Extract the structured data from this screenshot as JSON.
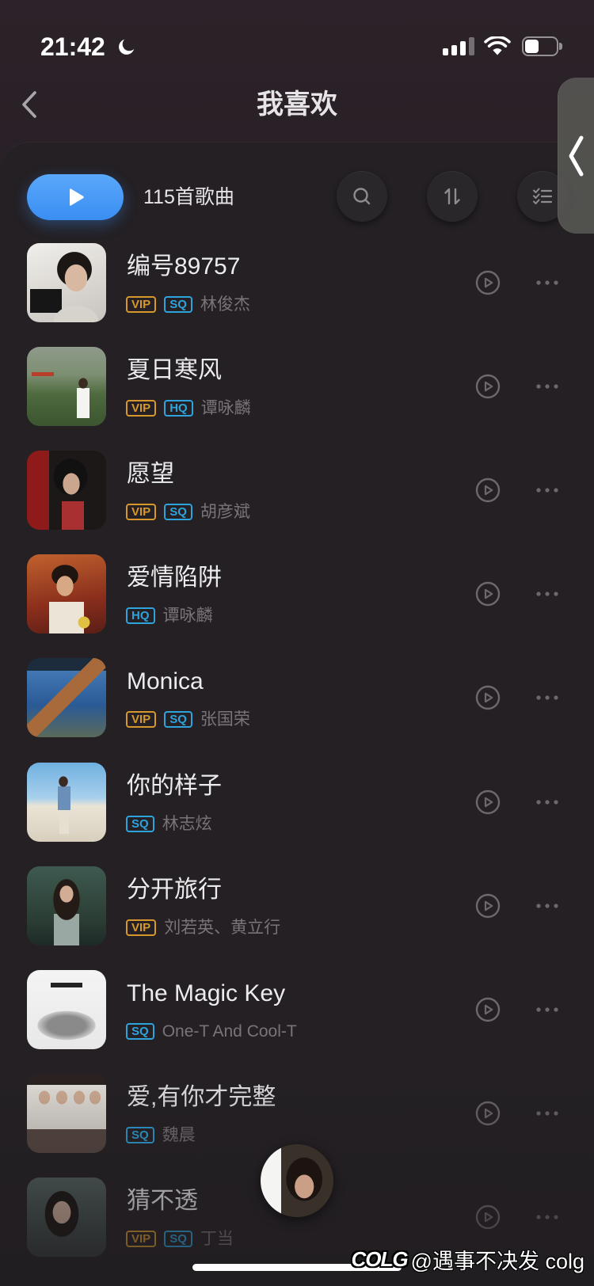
{
  "status_bar": {
    "time": "21:42",
    "signal_bars": 3,
    "battery_level": 0.45,
    "icons": [
      "moon-icon",
      "cellular-signal-icon",
      "wifi-icon",
      "battery-icon"
    ]
  },
  "header": {
    "title": "我喜欢",
    "back_icon": "chevron-left-icon"
  },
  "toolbar": {
    "play_all_icon": "play-icon",
    "song_count": "115首歌曲",
    "search_icon": "search-icon",
    "sort_icon": "sort-icon",
    "manage_icon": "checklist-icon"
  },
  "side_drawer": {
    "icon": "chevron-left-icon"
  },
  "songs": [
    {
      "title": "编号89757",
      "badges": [
        "VIP",
        "SQ"
      ],
      "artist": "林俊杰"
    },
    {
      "title": "夏日寒风",
      "badges": [
        "VIP",
        "HQ"
      ],
      "artist": "谭咏麟"
    },
    {
      "title": "愿望",
      "badges": [
        "VIP",
        "SQ"
      ],
      "artist": "胡彦斌"
    },
    {
      "title": "爱情陷阱",
      "badges": [
        "HQ"
      ],
      "artist": "谭咏麟"
    },
    {
      "title": "Monica",
      "badges": [
        "VIP",
        "SQ"
      ],
      "artist": "张国荣"
    },
    {
      "title": "你的样子",
      "badges": [
        "SQ"
      ],
      "artist": "林志炫"
    },
    {
      "title": "分开旅行",
      "badges": [
        "VIP"
      ],
      "artist": "刘若英、黄立行"
    },
    {
      "title": "The Magic Key",
      "badges": [
        "SQ"
      ],
      "artist": "One-T And Cool-T"
    },
    {
      "title": "爱,有你才完整",
      "badges": [
        "SQ"
      ],
      "artist": "魏晨"
    },
    {
      "title": "猜不透",
      "badges": [
        "VIP",
        "SQ"
      ],
      "artist": "丁当"
    }
  ],
  "row_icons": {
    "play": "play-circle-icon",
    "more": "more-dots-icon"
  },
  "watermark": {
    "logo": "COLG",
    "text": "@遇事不决发 colg"
  },
  "theme": {
    "background": "#231f23",
    "accent": "#3a8ef2",
    "vip": "#d6982c",
    "quality": "#2ea3dc",
    "text_primary": "#ececec",
    "text_secondary": "#78747a"
  }
}
